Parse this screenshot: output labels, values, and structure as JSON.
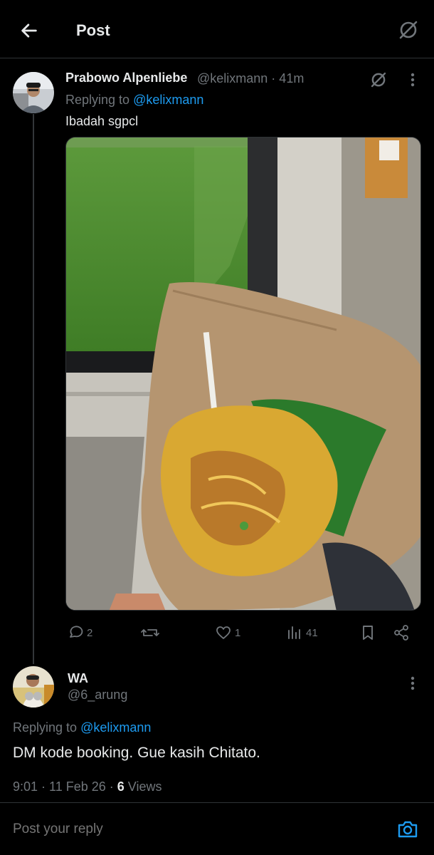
{
  "header": {
    "title": "Post"
  },
  "post1": {
    "author_name": "Prabowo Alpenliebe",
    "meta": "@kelixmann · 41m",
    "replying_prefix": "Replying to ",
    "replying_handle": "@kelixmann",
    "text": "Ibadah sgpcl",
    "stats": {
      "replies": "2",
      "reposts": "",
      "likes": "1",
      "views": "41"
    }
  },
  "post2": {
    "author_name": "WA",
    "handle": "@6_arung",
    "replying_prefix": "Replying to ",
    "replying_handle": "@kelixmann",
    "text": "DM kode booking. Gue kasih Chitato.",
    "time_date": "9:01 · 11 Feb 26 · ",
    "views_count": "6",
    "views_label": " Views"
  },
  "reply_bar": {
    "placeholder": "Post your reply"
  },
  "colors": {
    "accent": "#1d9bf0",
    "muted": "#71767b",
    "text": "#e7e9ea",
    "background": "#000000"
  },
  "icons": [
    "back-arrow-icon",
    "grok-icon",
    "more-icon",
    "reply-icon",
    "repost-icon",
    "like-icon",
    "views-icon",
    "bookmark-icon",
    "share-icon",
    "camera-icon"
  ]
}
